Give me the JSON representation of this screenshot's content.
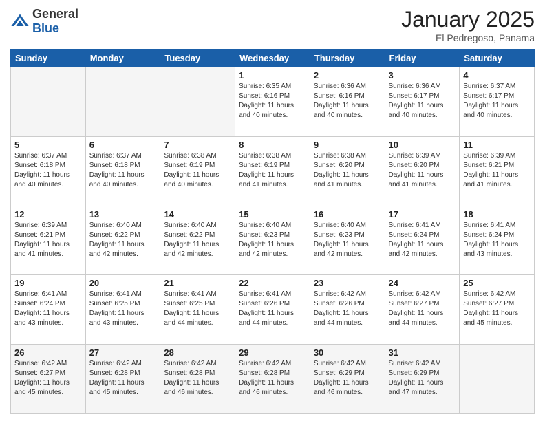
{
  "header": {
    "logo_general": "General",
    "logo_blue": "Blue",
    "month_title": "January 2025",
    "location": "El Pedregoso, Panama"
  },
  "weekdays": [
    "Sunday",
    "Monday",
    "Tuesday",
    "Wednesday",
    "Thursday",
    "Friday",
    "Saturday"
  ],
  "weeks": [
    [
      {
        "day": "",
        "info": ""
      },
      {
        "day": "",
        "info": ""
      },
      {
        "day": "",
        "info": ""
      },
      {
        "day": "1",
        "info": "Sunrise: 6:35 AM\nSunset: 6:16 PM\nDaylight: 11 hours and 40 minutes."
      },
      {
        "day": "2",
        "info": "Sunrise: 6:36 AM\nSunset: 6:16 PM\nDaylight: 11 hours and 40 minutes."
      },
      {
        "day": "3",
        "info": "Sunrise: 6:36 AM\nSunset: 6:17 PM\nDaylight: 11 hours and 40 minutes."
      },
      {
        "day": "4",
        "info": "Sunrise: 6:37 AM\nSunset: 6:17 PM\nDaylight: 11 hours and 40 minutes."
      }
    ],
    [
      {
        "day": "5",
        "info": "Sunrise: 6:37 AM\nSunset: 6:18 PM\nDaylight: 11 hours and 40 minutes."
      },
      {
        "day": "6",
        "info": "Sunrise: 6:37 AM\nSunset: 6:18 PM\nDaylight: 11 hours and 40 minutes."
      },
      {
        "day": "7",
        "info": "Sunrise: 6:38 AM\nSunset: 6:19 PM\nDaylight: 11 hours and 40 minutes."
      },
      {
        "day": "8",
        "info": "Sunrise: 6:38 AM\nSunset: 6:19 PM\nDaylight: 11 hours and 41 minutes."
      },
      {
        "day": "9",
        "info": "Sunrise: 6:38 AM\nSunset: 6:20 PM\nDaylight: 11 hours and 41 minutes."
      },
      {
        "day": "10",
        "info": "Sunrise: 6:39 AM\nSunset: 6:20 PM\nDaylight: 11 hours and 41 minutes."
      },
      {
        "day": "11",
        "info": "Sunrise: 6:39 AM\nSunset: 6:21 PM\nDaylight: 11 hours and 41 minutes."
      }
    ],
    [
      {
        "day": "12",
        "info": "Sunrise: 6:39 AM\nSunset: 6:21 PM\nDaylight: 11 hours and 41 minutes."
      },
      {
        "day": "13",
        "info": "Sunrise: 6:40 AM\nSunset: 6:22 PM\nDaylight: 11 hours and 42 minutes."
      },
      {
        "day": "14",
        "info": "Sunrise: 6:40 AM\nSunset: 6:22 PM\nDaylight: 11 hours and 42 minutes."
      },
      {
        "day": "15",
        "info": "Sunrise: 6:40 AM\nSunset: 6:23 PM\nDaylight: 11 hours and 42 minutes."
      },
      {
        "day": "16",
        "info": "Sunrise: 6:40 AM\nSunset: 6:23 PM\nDaylight: 11 hours and 42 minutes."
      },
      {
        "day": "17",
        "info": "Sunrise: 6:41 AM\nSunset: 6:24 PM\nDaylight: 11 hours and 42 minutes."
      },
      {
        "day": "18",
        "info": "Sunrise: 6:41 AM\nSunset: 6:24 PM\nDaylight: 11 hours and 43 minutes."
      }
    ],
    [
      {
        "day": "19",
        "info": "Sunrise: 6:41 AM\nSunset: 6:24 PM\nDaylight: 11 hours and 43 minutes."
      },
      {
        "day": "20",
        "info": "Sunrise: 6:41 AM\nSunset: 6:25 PM\nDaylight: 11 hours and 43 minutes."
      },
      {
        "day": "21",
        "info": "Sunrise: 6:41 AM\nSunset: 6:25 PM\nDaylight: 11 hours and 44 minutes."
      },
      {
        "day": "22",
        "info": "Sunrise: 6:41 AM\nSunset: 6:26 PM\nDaylight: 11 hours and 44 minutes."
      },
      {
        "day": "23",
        "info": "Sunrise: 6:42 AM\nSunset: 6:26 PM\nDaylight: 11 hours and 44 minutes."
      },
      {
        "day": "24",
        "info": "Sunrise: 6:42 AM\nSunset: 6:27 PM\nDaylight: 11 hours and 44 minutes."
      },
      {
        "day": "25",
        "info": "Sunrise: 6:42 AM\nSunset: 6:27 PM\nDaylight: 11 hours and 45 minutes."
      }
    ],
    [
      {
        "day": "26",
        "info": "Sunrise: 6:42 AM\nSunset: 6:27 PM\nDaylight: 11 hours and 45 minutes."
      },
      {
        "day": "27",
        "info": "Sunrise: 6:42 AM\nSunset: 6:28 PM\nDaylight: 11 hours and 45 minutes."
      },
      {
        "day": "28",
        "info": "Sunrise: 6:42 AM\nSunset: 6:28 PM\nDaylight: 11 hours and 46 minutes."
      },
      {
        "day": "29",
        "info": "Sunrise: 6:42 AM\nSunset: 6:28 PM\nDaylight: 11 hours and 46 minutes."
      },
      {
        "day": "30",
        "info": "Sunrise: 6:42 AM\nSunset: 6:29 PM\nDaylight: 11 hours and 46 minutes."
      },
      {
        "day": "31",
        "info": "Sunrise: 6:42 AM\nSunset: 6:29 PM\nDaylight: 11 hours and 47 minutes."
      },
      {
        "day": "",
        "info": ""
      }
    ]
  ]
}
